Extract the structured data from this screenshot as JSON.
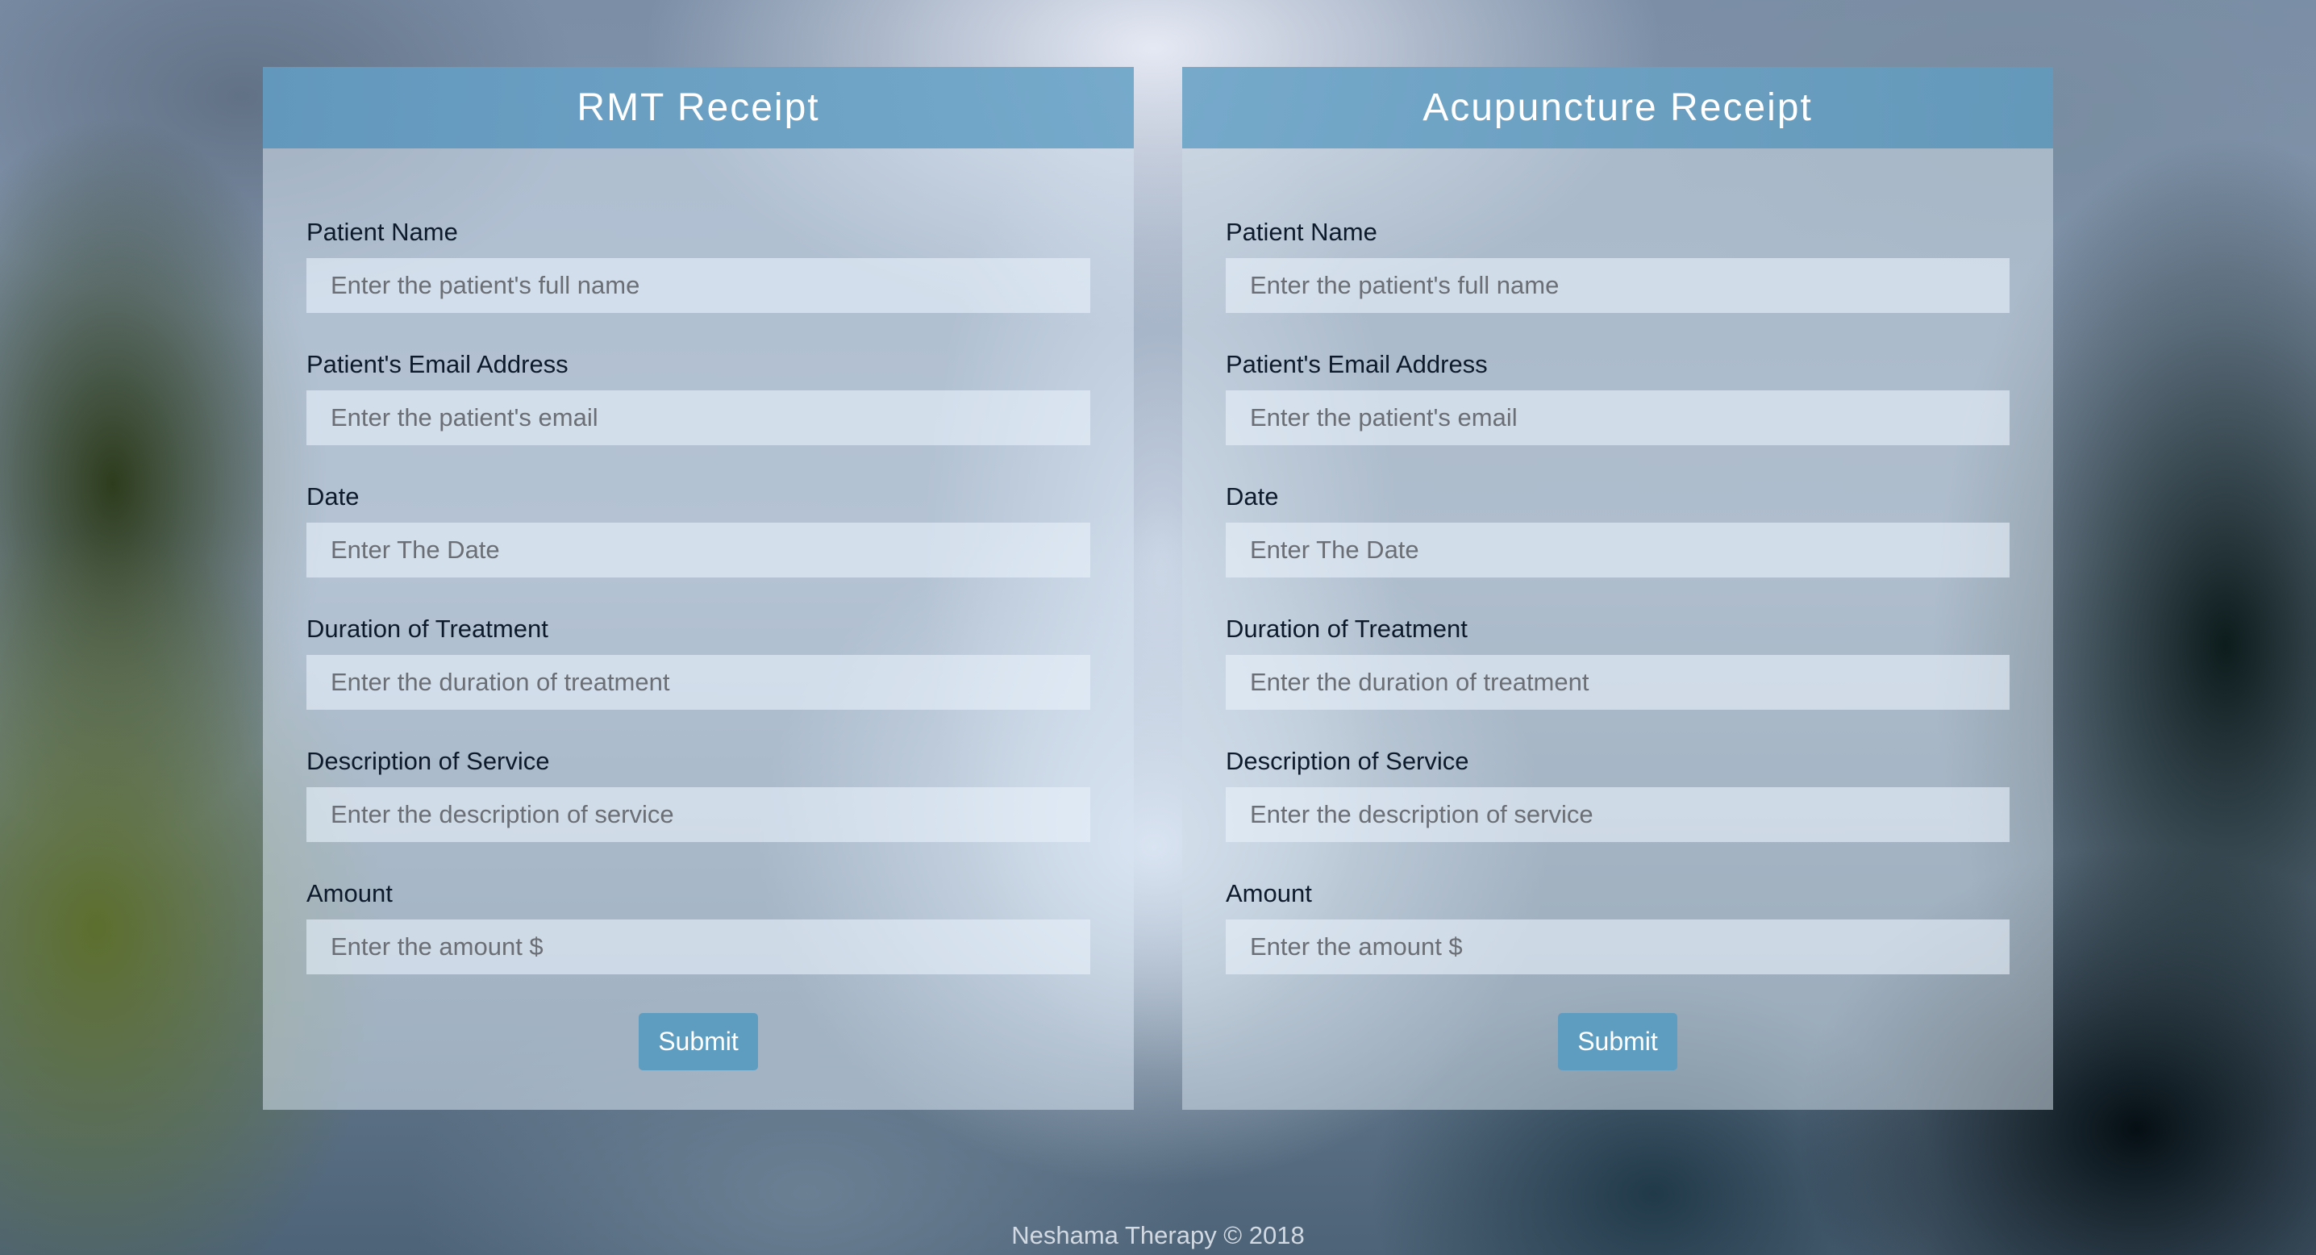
{
  "forms": [
    {
      "title": "RMT Receipt",
      "fields": [
        {
          "label": "Patient Name",
          "placeholder": "Enter the patient's full name",
          "value": ""
        },
        {
          "label": "Patient's Email Address",
          "placeholder": "Enter the patient's email",
          "value": ""
        },
        {
          "label": "Date",
          "placeholder": "Enter The Date",
          "value": ""
        },
        {
          "label": "Duration of Treatment",
          "placeholder": "Enter the duration of treatment",
          "value": ""
        },
        {
          "label": "Description of Service",
          "placeholder": "Enter the description of service",
          "value": ""
        },
        {
          "label": "Amount",
          "placeholder": "Enter the amount $",
          "value": ""
        }
      ],
      "submit_label": "Submit"
    },
    {
      "title": "Acupuncture Receipt",
      "fields": [
        {
          "label": "Patient Name",
          "placeholder": "Enter the patient's full name",
          "value": ""
        },
        {
          "label": "Patient's Email Address",
          "placeholder": "Enter the patient's email",
          "value": ""
        },
        {
          "label": "Date",
          "placeholder": "Enter The Date",
          "value": ""
        },
        {
          "label": "Duration of Treatment",
          "placeholder": "Enter the duration of treatment",
          "value": ""
        },
        {
          "label": "Description of Service",
          "placeholder": "Enter the description of service",
          "value": ""
        },
        {
          "label": "Amount",
          "placeholder": "Enter the amount $",
          "value": ""
        }
      ],
      "submit_label": "Submit"
    }
  ],
  "footer": {
    "text": "Neshama Therapy © 2018"
  },
  "colors": {
    "header_accent": "#5e9cc0",
    "button": "#5e9cc0",
    "label_text": "#0d1a2b",
    "footer_text": "#d2d9e2"
  }
}
